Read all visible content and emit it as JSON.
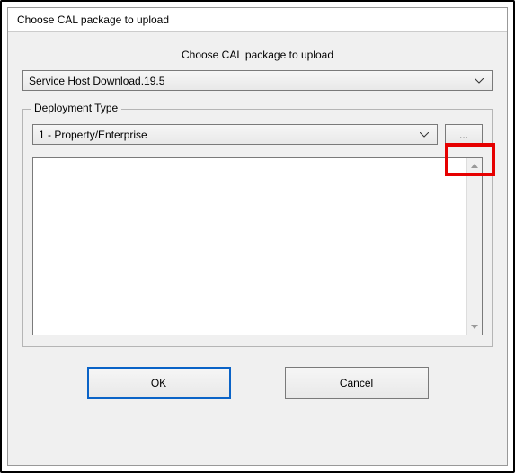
{
  "window": {
    "title": "Choose CAL package to upload"
  },
  "header": {
    "label": "Choose CAL package to upload"
  },
  "package_combo": {
    "selected": "Service Host Download.19.5"
  },
  "deployment": {
    "legend": "Deployment Type",
    "type_combo": {
      "selected": "1 - Property/Enterprise"
    },
    "browse_label": "..."
  },
  "buttons": {
    "ok": "OK",
    "cancel": "Cancel"
  }
}
